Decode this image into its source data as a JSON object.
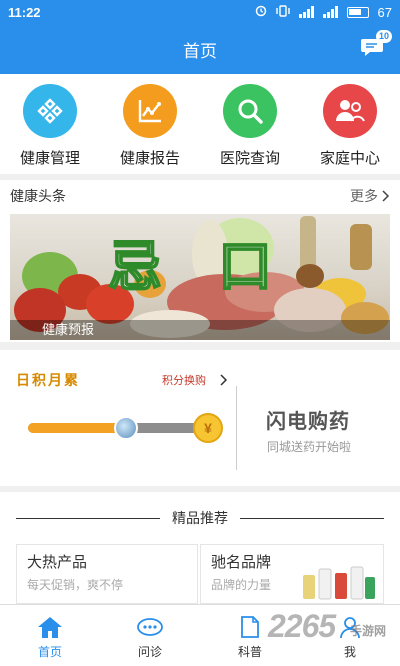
{
  "status_bar": {
    "time": "11:22",
    "battery": "67"
  },
  "header": {
    "title": "首页",
    "message_count": "10"
  },
  "quick_actions": [
    {
      "label": "健康管理",
      "icon": "health-management-icon",
      "color": "#34b6ea"
    },
    {
      "label": "健康报告",
      "icon": "health-report-icon",
      "color": "#f39c1e"
    },
    {
      "label": "医院查询",
      "icon": "search-icon",
      "color": "#3cc361"
    },
    {
      "label": "家庭中心",
      "icon": "family-icon",
      "color": "#e8474a"
    }
  ],
  "news": {
    "title": "健康头条",
    "more": "更多",
    "banner_headline": "忌口",
    "banner_caption": "健康预报"
  },
  "points": {
    "title": "日积月累",
    "exchange_link": "积分换购",
    "progress": 0.62,
    "coin_symbol": "¥",
    "flash_title": "闪电购药",
    "flash_sub": "同城送药开始啦"
  },
  "featured": {
    "title": "精品推荐",
    "cards": [
      {
        "title": "大热产品",
        "subtitle": "每天促销，爽不停"
      },
      {
        "title": "驰名品牌",
        "subtitle": "品牌的力量"
      }
    ]
  },
  "tabs": [
    {
      "label": "首页",
      "icon": "home-icon",
      "active": true
    },
    {
      "label": "问诊",
      "icon": "chat-icon",
      "active": false
    },
    {
      "label": "科普",
      "icon": "document-icon",
      "active": false
    },
    {
      "label": "我",
      "icon": "user-icon",
      "active": false
    }
  ],
  "watermark": {
    "text": "2265",
    "suffix": "手游网"
  },
  "colors": {
    "primary": "#2a8fea",
    "accent": "#f2a123"
  }
}
